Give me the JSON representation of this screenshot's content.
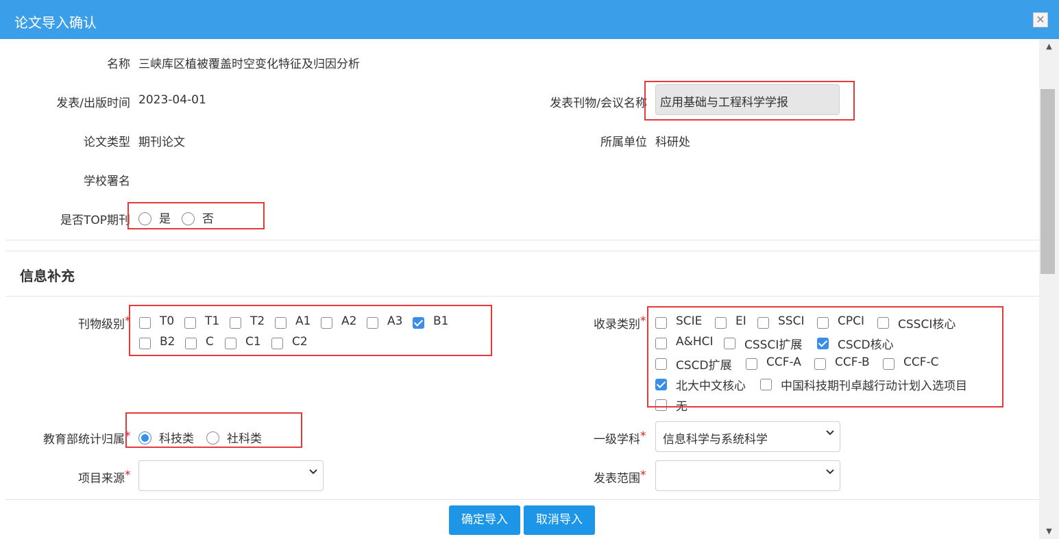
{
  "dialog": {
    "title": "论文导入确认",
    "close_glyph": "✕"
  },
  "fields": {
    "name": {
      "label": "名称",
      "value": "三峡库区植被覆盖时空变化特征及归因分析"
    },
    "publish_time": {
      "label": "发表/出版时间",
      "value": "2023-04-01"
    },
    "journal": {
      "label": "发表刊物/会议名称",
      "value": "应用基础与工程科学学报"
    },
    "paper_type": {
      "label": "论文类型",
      "value": "期刊论文"
    },
    "unit": {
      "label": "所属单位",
      "value": "科研处"
    },
    "school_sign": {
      "label": "学校署名",
      "value": ""
    },
    "top_journal": {
      "label": "是否TOP期刊",
      "options": [
        "是",
        "否"
      ],
      "selected": null
    }
  },
  "supplement": {
    "title": "信息补充",
    "journal_level": {
      "label": "刊物级别",
      "required_mark": "*",
      "options": [
        {
          "label": "T0",
          "checked": false
        },
        {
          "label": "T1",
          "checked": false
        },
        {
          "label": "T2",
          "checked": false
        },
        {
          "label": "A1",
          "checked": false
        },
        {
          "label": "A2",
          "checked": false
        },
        {
          "label": "A3",
          "checked": false
        },
        {
          "label": "B1",
          "checked": true
        },
        {
          "label": "B2",
          "checked": false
        },
        {
          "label": "C",
          "checked": false
        },
        {
          "label": "C1",
          "checked": false
        },
        {
          "label": "C2",
          "checked": false
        }
      ]
    },
    "index_category": {
      "label": "收录类别",
      "required_mark": "*",
      "options": [
        {
          "label": "SCIE",
          "checked": false
        },
        {
          "label": "EI",
          "checked": false
        },
        {
          "label": "SSCI",
          "checked": false
        },
        {
          "label": "CPCI",
          "checked": false
        },
        {
          "label": "CSSCI核心",
          "checked": false
        },
        {
          "label": "A&HCI",
          "checked": false
        },
        {
          "label": "CSSCI扩展",
          "checked": false
        },
        {
          "label": "CSCD核心",
          "checked": true
        },
        {
          "label": "CSCD扩展",
          "checked": false
        },
        {
          "label": "CCF-A",
          "checked": false
        },
        {
          "label": "CCF-B",
          "checked": false
        },
        {
          "label": "CCF-C",
          "checked": false
        },
        {
          "label": "北大中文核心",
          "checked": true
        },
        {
          "label": "中国科技期刊卓越行动计划入选项目",
          "checked": false
        },
        {
          "label": "无",
          "checked": false
        }
      ]
    },
    "moe_category": {
      "label": "教育部统计归属",
      "required_mark": "*",
      "options": [
        "科技类",
        "社科类"
      ],
      "selected": "科技类"
    },
    "first_discipline": {
      "label": "一级学科",
      "required_mark": "*",
      "value": "信息科学与系统科学"
    },
    "project_source": {
      "label": "项目来源",
      "required_mark": "*",
      "value": ""
    },
    "publish_scope": {
      "label": "发表范围",
      "required_mark": "*",
      "value": ""
    }
  },
  "buttons": {
    "confirm": "确定导入",
    "cancel": "取消导入"
  },
  "colors": {
    "titlebar": "#3a9ee8",
    "button": "#1e96e8",
    "highlight_box": "#e23a3a",
    "check": "#3a8ee8",
    "required": "#e02020"
  }
}
